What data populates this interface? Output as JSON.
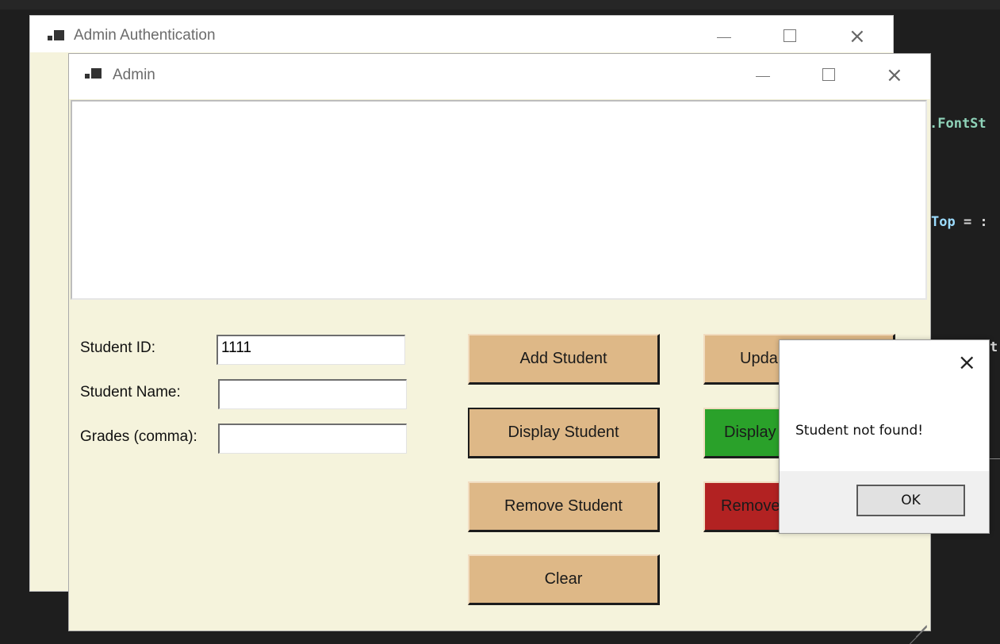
{
  "background_code": {
    "fragment_1": ".FontSt",
    "fragment_2_name": "Top",
    "fragment_2_op": " = :",
    "fragment_3": "t:"
  },
  "auth_window": {
    "title": "Admin Authentication",
    "minimize": "—",
    "close": "×"
  },
  "admin_window": {
    "title": "Admin",
    "output_text": "",
    "form": {
      "student_id_label": "Student ID:",
      "student_id_value": "1111",
      "student_name_label": "Student Name:",
      "student_name_value": "",
      "grades_label": "Grades (comma):",
      "grades_value": ""
    },
    "buttons": {
      "add": "Add Student",
      "display": "Display Student",
      "remove": "Remove Student",
      "clear": "Clear",
      "update": "Upda",
      "display_all": "Display",
      "remove_all": "Remove"
    },
    "colors": {
      "button": "#deb887",
      "display_all": "#2aa12a",
      "remove_all": "#b22222",
      "form_bg": "#f5f3dc"
    }
  },
  "message_box": {
    "text": "Student not found!",
    "ok_label": "OK",
    "close": "×"
  },
  "icons": [
    "app-icon",
    "minimize-icon",
    "maximize-icon",
    "close-icon",
    "resize-grip-icon"
  ]
}
